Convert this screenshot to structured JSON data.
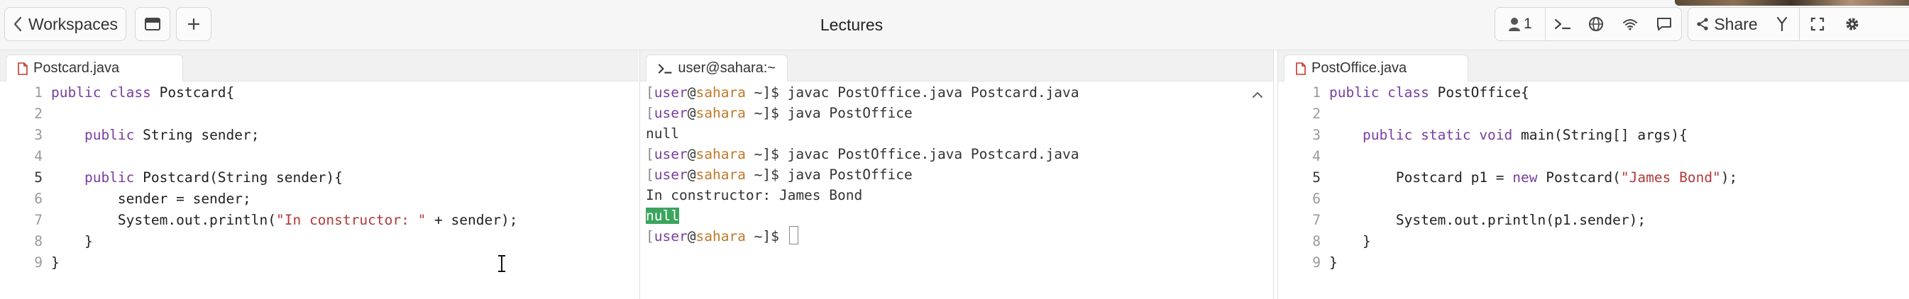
{
  "toolbar": {
    "back_label": "Workspaces",
    "title": "Lectures",
    "participant_count": "1",
    "share_label": "Share"
  },
  "icons": {
    "back": "chevron-left-icon",
    "sidebar": "sidebar-icon",
    "add": "plus-icon",
    "user": "user-icon",
    "terminal": "terminal-icon",
    "globe": "globe-icon",
    "wifi": "wifi-icon",
    "chat": "chat-icon",
    "share": "share-icon",
    "fork": "fork-icon",
    "fullscreen": "fullscreen-icon",
    "settings": "gear-icon"
  },
  "left_editor": {
    "tab": "Postcard.java",
    "lines": {
      "l1": {
        "num": "1",
        "a": "public class",
        "b": " Postcard{"
      },
      "l2": {
        "num": "2"
      },
      "l3": {
        "num": "3",
        "a": "    public",
        "b": " String sender;"
      },
      "l4": {
        "num": "4"
      },
      "l5": {
        "num": "5",
        "a": "    public",
        "b": " Postcard(String sender){"
      },
      "l6": {
        "num": "6",
        "a": "        sender = sender;"
      },
      "l7": {
        "num": "7",
        "a": "        System.out.println(",
        "s": "\"In constructor: \"",
        "b": " + sender);"
      },
      "l8": {
        "num": "8",
        "a": "    }"
      },
      "l9": {
        "num": "9",
        "a": "}"
      }
    }
  },
  "terminal": {
    "tab": "user@sahara:~",
    "prompt": {
      "open": "[",
      "user": "user",
      "at": "@",
      "host": "sahara",
      "path": " ~]$ "
    },
    "commands": {
      "c1": "javac PostOffice.java Postcard.java",
      "c2": "java PostOffice",
      "c3": "javac PostOffice.java Postcard.java",
      "c4": "java PostOffice"
    },
    "outputs": {
      "o1": "null",
      "o2": "In constructor: James Bond",
      "o3": "null"
    }
  },
  "right_editor": {
    "tab": "PostOffice.java",
    "lines": {
      "l1": {
        "num": "1",
        "a": "public class",
        "b": " PostOffice{"
      },
      "l2": {
        "num": "2"
      },
      "l3": {
        "num": "3",
        "a": "    public static void",
        "b": " main(String[] args){"
      },
      "l4": {
        "num": "4"
      },
      "l5": {
        "num": "5",
        "a": "        Postcard p1 = ",
        "k": "new",
        "b": " Postcard(",
        "s": "\"James Bond\"",
        "c": ");"
      },
      "l6": {
        "num": "6"
      },
      "l7": {
        "num": "7",
        "a": "        System.out.println(p1.sender);"
      },
      "l8": {
        "num": "8",
        "a": "    }"
      },
      "l9": {
        "num": "9",
        "a": "}"
      }
    }
  }
}
